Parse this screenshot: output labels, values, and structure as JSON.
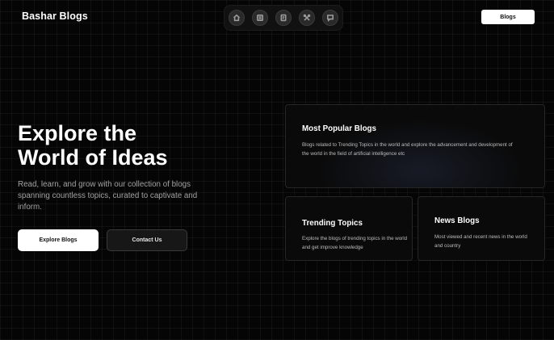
{
  "header": {
    "brand": "Bashar Blogs",
    "nav_icons": [
      "home-icon",
      "blog-list-icon",
      "book-icon",
      "tools-icon",
      "chat-icon"
    ],
    "blogs_button": "Blogs"
  },
  "hero": {
    "title_line1": "Explore the",
    "title_line2": "World of Ideas",
    "subtitle": "Read, learn, and grow with our collection of blogs spanning countless topics, curated to captivate and inform.",
    "primary_button": "Explore Blogs",
    "secondary_button": "Contact Us"
  },
  "cards": {
    "popular": {
      "title": "Most Popular Blogs",
      "description": "Blogs related to Trending Topics in the world and explore the advancement and development of the world in the field of artificial intelligence etc"
    },
    "trending": {
      "title": "Trending Topics",
      "description": "Explore the blogs of trending topics in the world and get improve knowledge"
    },
    "news": {
      "title": "News Blogs",
      "description": "Most viewed and recent news in the world and country"
    }
  },
  "colors": {
    "background": "#050505",
    "card": "#0a0a0a",
    "accent_button": "#ffffff",
    "muted_text": "#a3a3a3"
  }
}
